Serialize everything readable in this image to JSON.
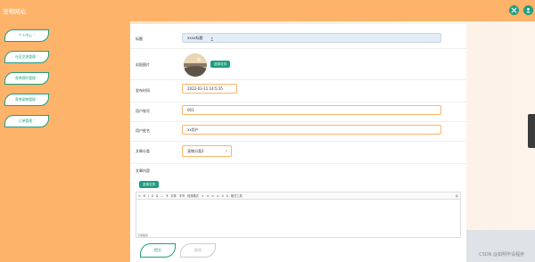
{
  "app": {
    "title": "宠物网站"
  },
  "sidebar": {
    "items": [
      {
        "label": "个人中心 ˅"
      },
      {
        "label": "社区交流管理 ˅"
      },
      {
        "label": "寄养预约管理 ˅"
      },
      {
        "label": "寄养宠物管理 ˅"
      },
      {
        "label": "订单管理 ˅"
      }
    ]
  },
  "form": {
    "title_label": "标题",
    "title_value": "xxxx标题",
    "cover_label": "封面图片",
    "cover_button": "选择文件",
    "time_label": "发布时间",
    "time_value": "2022-03-11 14:5:35",
    "account_label": "用户账号",
    "account_value": "001",
    "name_label": "用户姓名",
    "name_value": "xx用户",
    "category_label": "文章分类",
    "category_value": "宠物分类2",
    "content_label": "文章内容",
    "content_button": "选择文件",
    "editor_path": "元素路径"
  },
  "editor_toolbar": [
    "⟲",
    "B",
    "I",
    "U",
    "S̶",
    "—",
    "¶",
    "字体",
    "字号",
    "段落格式",
    "≡",
    "≡",
    "≡",
    "≡",
    "A",
    "A",
    "格式工具",
    "😊"
  ],
  "buttons": {
    "submit": "提交",
    "cancel": "取消"
  },
  "watermark": "CSDN @如明毕设程序",
  "colors": {
    "accent": "#1e9e80",
    "header": "#fdb46a"
  }
}
